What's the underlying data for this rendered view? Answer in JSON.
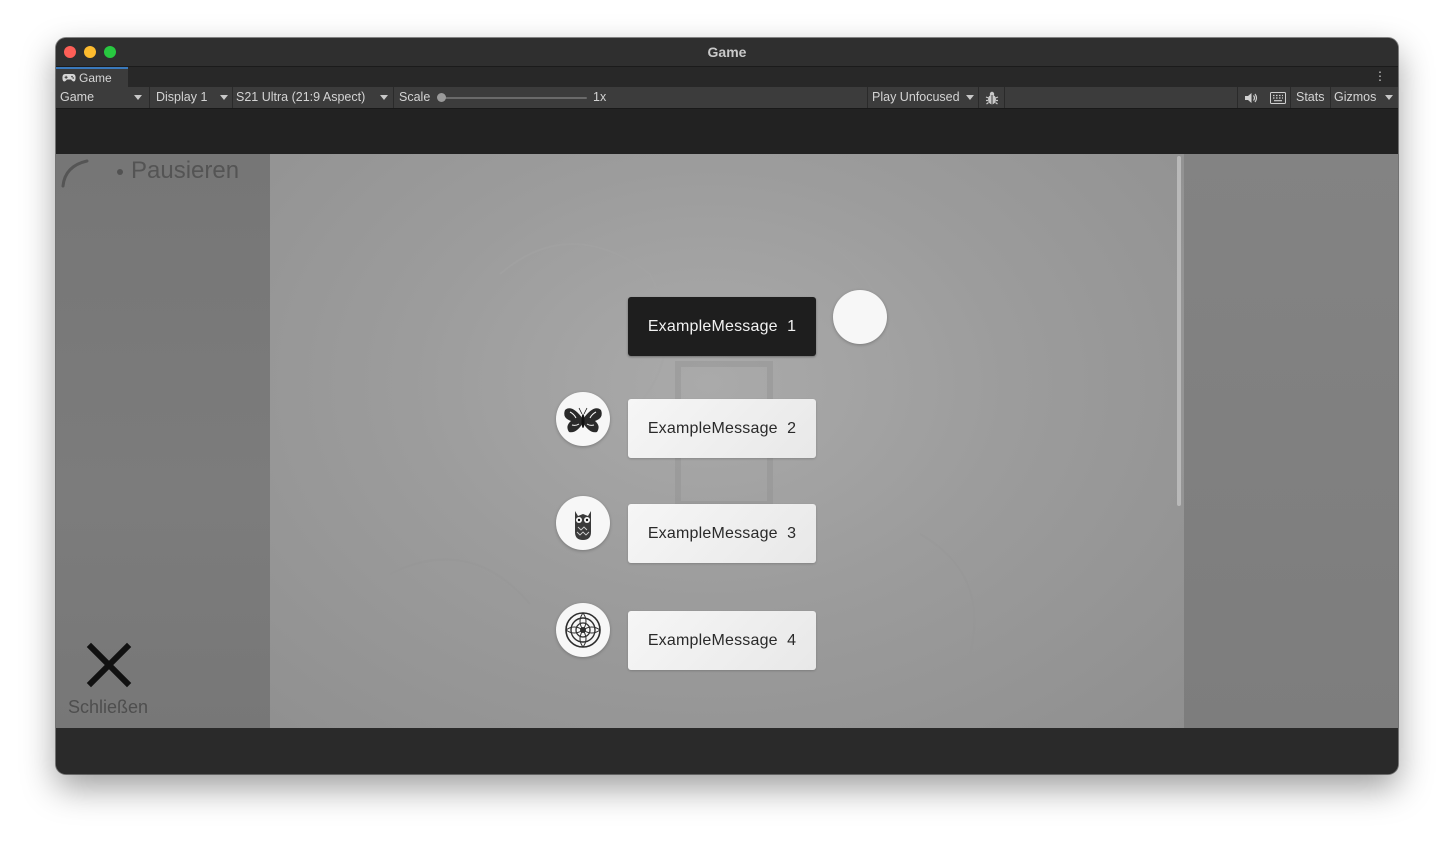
{
  "window": {
    "title": "Game"
  },
  "tab": {
    "label": "Game",
    "icon": "gamepad-icon"
  },
  "toolbar": {
    "view_mode": "Game",
    "display": "Display 1",
    "resolution": "S21 Ultra (21:9 Aspect)",
    "scale_label": "Scale",
    "scale_value": "1x",
    "play_mode": "Play Unfocused",
    "stats": "Stats",
    "gizmos": "Gizmos",
    "icons": [
      "bug-icon",
      "audio-icon",
      "keyboard-icon"
    ]
  },
  "game": {
    "pause_label": "Pausieren",
    "close_label": "Schließen",
    "messages": [
      {
        "text": "ExampleMessage  1",
        "style": "dark",
        "avatar": "blank-circle"
      },
      {
        "text": "ExampleMessage  2",
        "style": "light",
        "avatar": "butterfly-icon"
      },
      {
        "text": "ExampleMessage  3",
        "style": "light",
        "avatar": "owl-icon"
      },
      {
        "text": "ExampleMessage  4",
        "style": "light",
        "avatar": "flower-icon"
      }
    ]
  },
  "colors": {
    "dark_message": "#1e1e1e",
    "light_message": "#f2f2f2",
    "tab_accent": "#3a79bb"
  }
}
